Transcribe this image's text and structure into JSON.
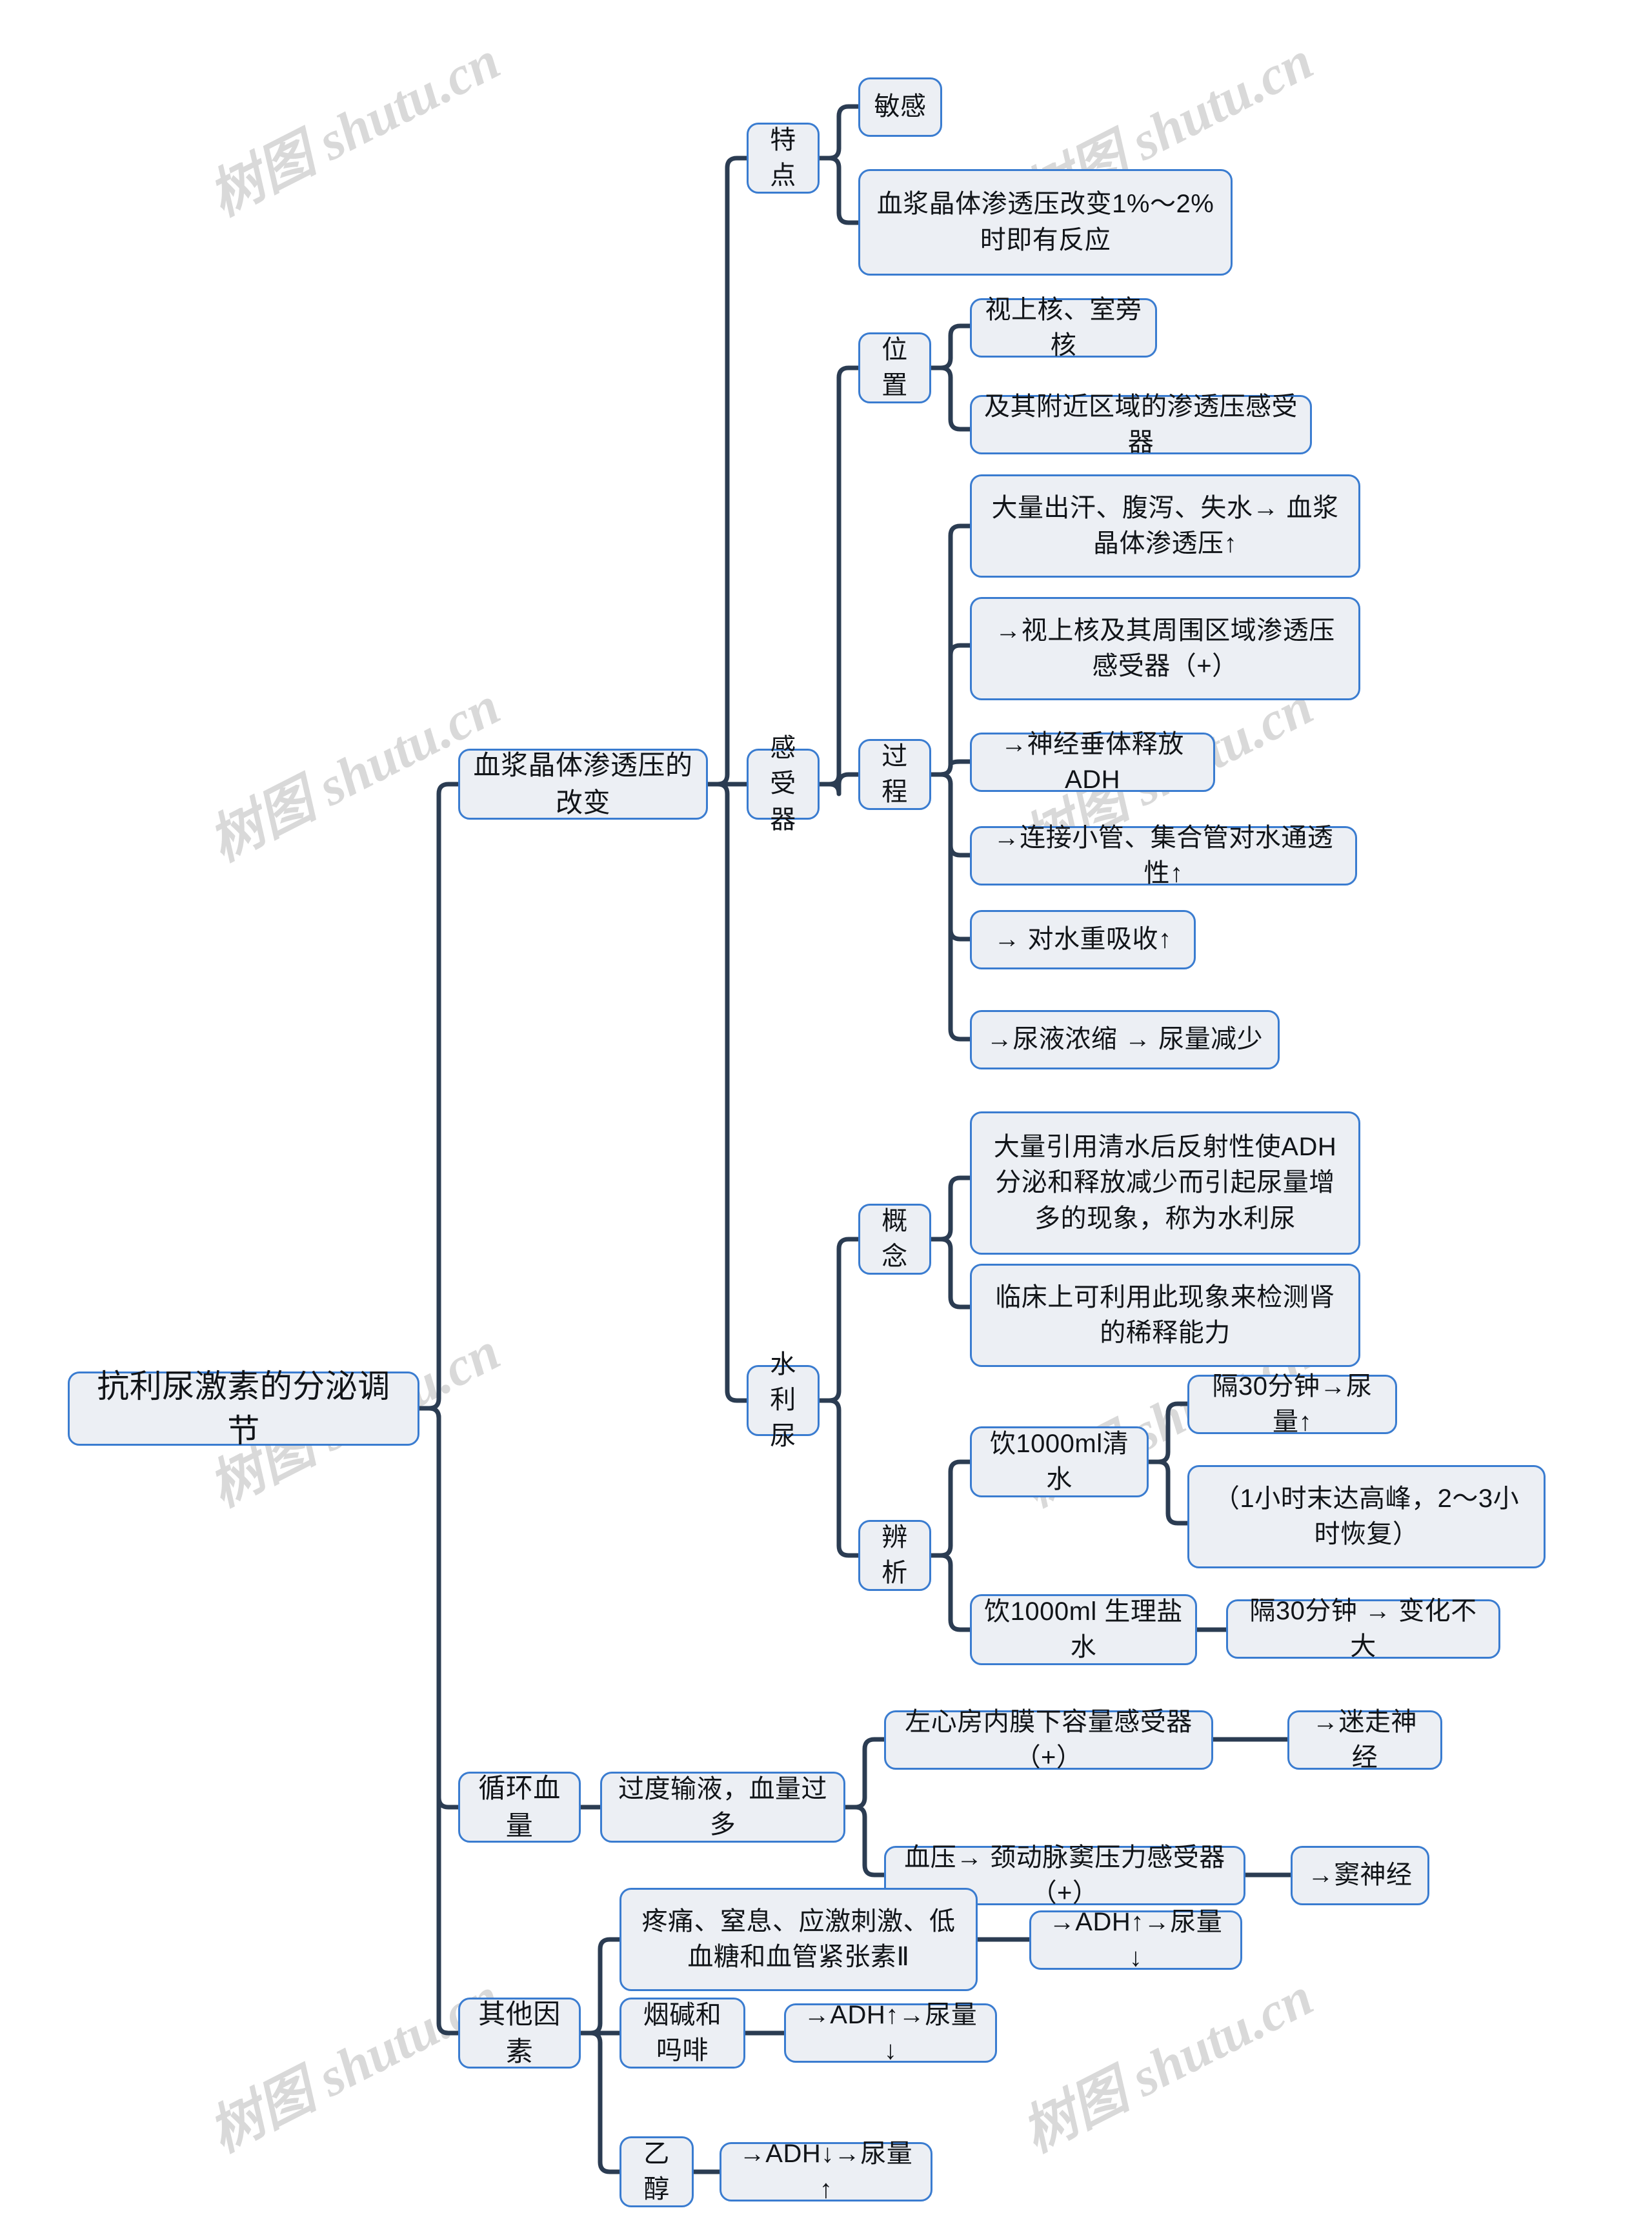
{
  "theme": {
    "background": "#ffffff",
    "node_fill": "#eceff4",
    "node_border": "#3a7cd0",
    "connector": "#2b3c52",
    "text": "#111418",
    "watermark": "#d9d9d9"
  },
  "watermark": {
    "text": "树图 shutu.cn",
    "rotation_deg": -27
  },
  "mindmap": {
    "title": "抗利尿激素的分泌调节",
    "root": {
      "label": "抗利尿激素的分泌调节"
    },
    "branches": [
      {
        "label": "血浆晶体渗透压的改变",
        "children": [
          {
            "label": "特点",
            "children": [
              {
                "label": "敏感"
              },
              {
                "label": "血浆晶体渗透压改变1%～2%时即有反应"
              }
            ]
          },
          {
            "label": "感受器",
            "children": [
              {
                "label": "位置",
                "children": [
                  {
                    "label": "视上核、室旁核"
                  },
                  {
                    "label": "及其附近区域的渗透压感受器"
                  }
                ]
              },
              {
                "label": "过程",
                "children": [
                  {
                    "label": "大量出汗、腹泻、失水→ 血浆晶体渗透压↑"
                  },
                  {
                    "label": "→视上核及其周围区域渗透压感受器（+）"
                  },
                  {
                    "label": "→神经垂体释放ADH"
                  },
                  {
                    "label": "→连接小管、集合管对水通透性↑"
                  },
                  {
                    "label": "→ 对水重吸收↑"
                  },
                  {
                    "label": "→尿液浓缩 →  尿量减少"
                  }
                ]
              }
            ]
          },
          {
            "label": "水利尿",
            "children": [
              {
                "label": "概念",
                "children": [
                  {
                    "label": "大量引用清水后反射性使ADH分泌和释放减少而引起尿量增多的现象，称为水利尿"
                  },
                  {
                    "label": "临床上可利用此现象来检测肾的稀释能力"
                  }
                ]
              },
              {
                "label": "辨析",
                "children": [
                  {
                    "label": "饮1000ml清水",
                    "children": [
                      {
                        "label": "隔30分钟→尿量↑"
                      },
                      {
                        "label": "（1小时末达高峰，2～3小时恢复）"
                      }
                    ]
                  },
                  {
                    "label": "饮1000ml 生理盐水",
                    "children": [
                      {
                        "label": "隔30分钟 →  变化不大"
                      }
                    ]
                  }
                ]
              }
            ]
          }
        ]
      },
      {
        "label": "循环血量",
        "children": [
          {
            "label": "过度输液，血量过多",
            "children": [
              {
                "label": "左心房内膜下容量感受器（+）",
                "children": [
                  {
                    "label": "→迷走神经"
                  }
                ]
              },
              {
                "label": "血压→ 颈动脉窦压力感受器（+）",
                "children": [
                  {
                    "label": "→窦神经"
                  }
                ]
              }
            ]
          }
        ]
      },
      {
        "label": "其他因素",
        "children": [
          {
            "label": "疼痛、窒息、应激刺激、低血糖和血管紧张素Ⅱ",
            "children": [
              {
                "label": "→ADH↑→尿量↓"
              }
            ]
          },
          {
            "label": "烟碱和吗啡",
            "children": [
              {
                "label": "→ADH↑→尿量↓"
              }
            ]
          },
          {
            "label": "乙醇",
            "children": [
              {
                "label": "→ADH↓→尿量↑"
              }
            ]
          }
        ]
      }
    ]
  },
  "nodes": {
    "root": {
      "label": "抗利尿激素的分泌调节"
    },
    "b1": {
      "label": "血浆晶体渗透压的改变"
    },
    "b1_tedian": {
      "label": "特点"
    },
    "b1_td_1": {
      "label": "敏感"
    },
    "b1_td_2": {
      "label": "血浆晶体渗透压改变1%～2%时即有反应"
    },
    "b1_ganshou": {
      "label": "感受器"
    },
    "b1_gs_weizhi": {
      "label": "位置"
    },
    "b1_gs_wz_1": {
      "label": "视上核、室旁核"
    },
    "b1_gs_wz_2": {
      "label": "及其附近区域的渗透压感受器"
    },
    "b1_gs_guocheng": {
      "label": "过程"
    },
    "b1_gs_gc_1": {
      "label": "大量出汗、腹泻、失水→ 血浆晶体渗透压↑"
    },
    "b1_gs_gc_2": {
      "label": "→视上核及其周围区域渗透压感受器（+）"
    },
    "b1_gs_gc_3": {
      "label": "→神经垂体释放ADH"
    },
    "b1_gs_gc_4": {
      "label": "→连接小管、集合管对水通透性↑"
    },
    "b1_gs_gc_5": {
      "label": "→ 对水重吸收↑"
    },
    "b1_gs_gc_6": {
      "label": "→尿液浓缩 →  尿量减少"
    },
    "b1_shuiliniao": {
      "label": "水利尿"
    },
    "b1_sl_gainian": {
      "label": "概念"
    },
    "b1_sl_gn_1": {
      "label": "大量引用清水后反射性使ADH分泌和释放减少而引起尿量增多的现象，称为水利尿"
    },
    "b1_sl_gn_2": {
      "label": "临床上可利用此现象来检测肾的稀释能力"
    },
    "b1_sl_bianxi": {
      "label": "辨析"
    },
    "b1_sl_bx_1": {
      "label": "饮1000ml清水"
    },
    "b1_sl_bx_1_a": {
      "label": "隔30分钟→尿量↑"
    },
    "b1_sl_bx_1_b": {
      "label": "（1小时末达高峰，2～3小时恢复）"
    },
    "b1_sl_bx_2": {
      "label": "饮1000ml 生理盐水"
    },
    "b1_sl_bx_2_a": {
      "label": "隔30分钟 →  变化不大"
    },
    "b2": {
      "label": "循环血量"
    },
    "b2_1": {
      "label": "过度输液，血量过多"
    },
    "b2_1_a": {
      "label": "左心房内膜下容量感受器（+）"
    },
    "b2_1_a_i": {
      "label": "→迷走神经"
    },
    "b2_1_b": {
      "label": "血压→ 颈动脉窦压力感受器（+）"
    },
    "b2_1_b_i": {
      "label": "→窦神经"
    },
    "b3": {
      "label": "其他因素"
    },
    "b3_1": {
      "label": "疼痛、窒息、应激刺激、低血糖和血管紧张素Ⅱ"
    },
    "b3_1_a": {
      "label": "→ADH↑→尿量↓"
    },
    "b3_2": {
      "label": "烟碱和吗啡"
    },
    "b3_2_a": {
      "label": "→ADH↑→尿量↓"
    },
    "b3_3": {
      "label": "乙醇"
    },
    "b3_3_a": {
      "label": "→ADH↓→尿量↑"
    }
  }
}
